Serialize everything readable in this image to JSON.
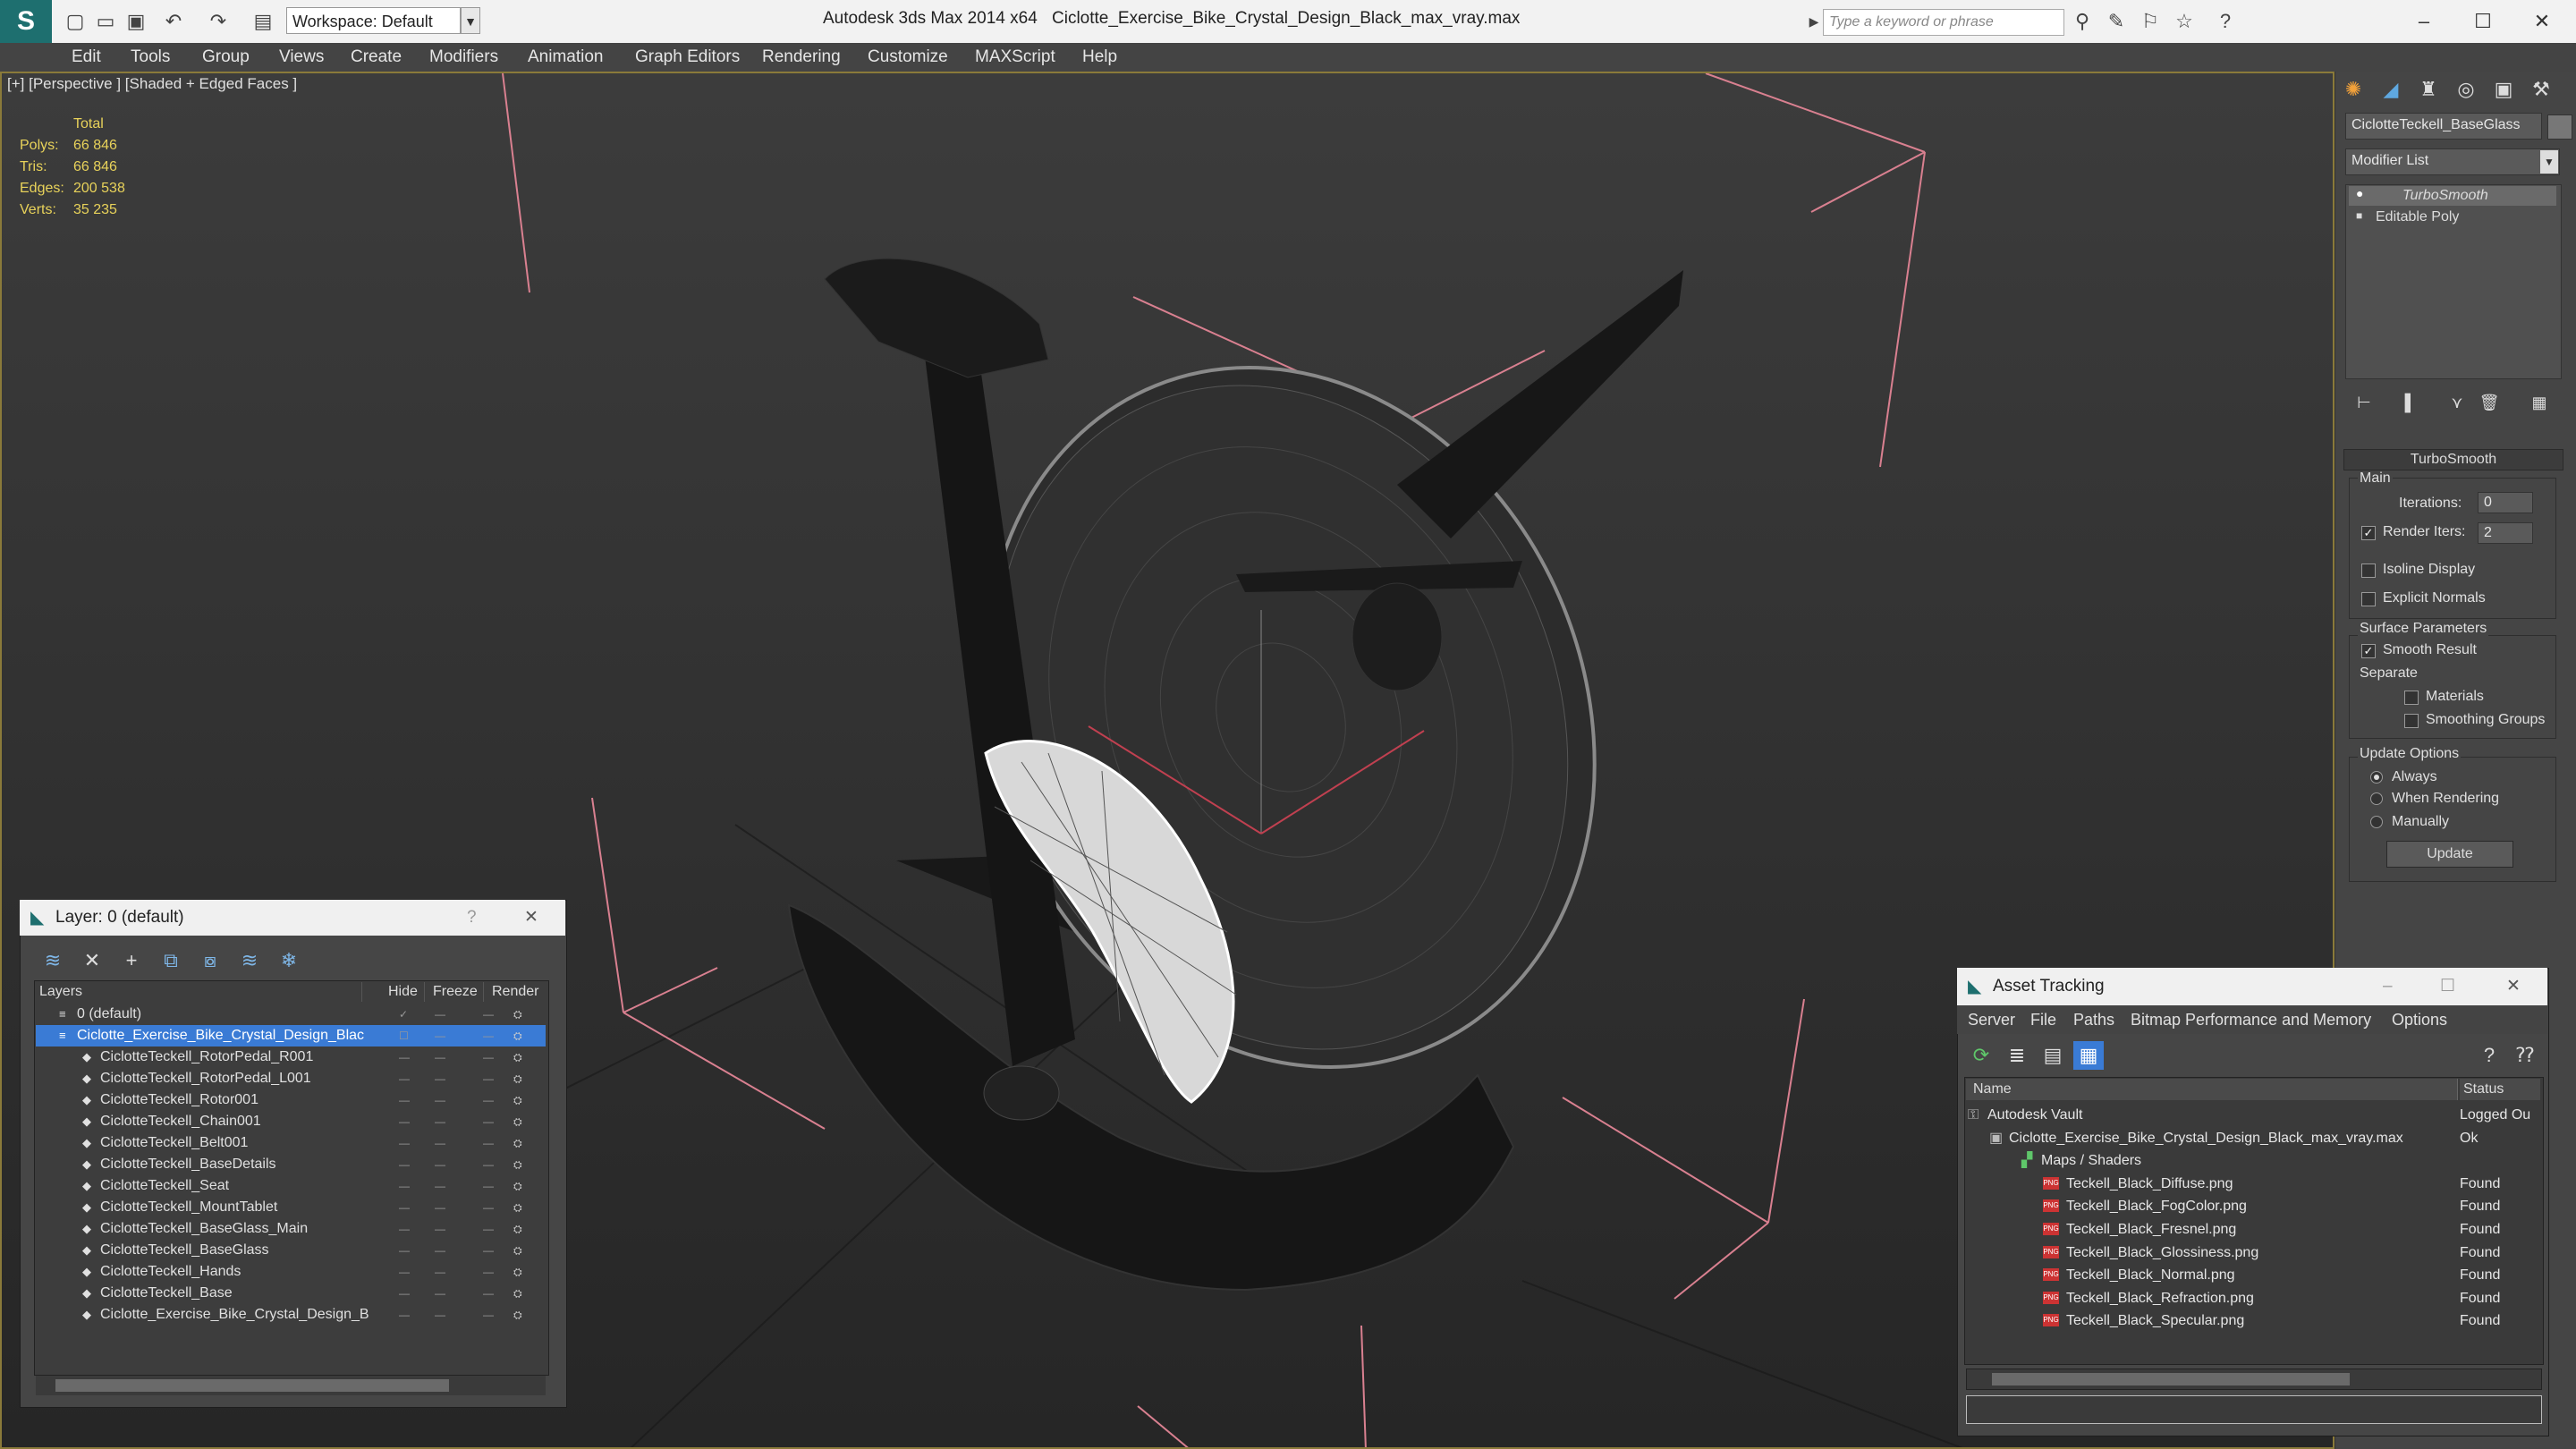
{
  "titlebar": {
    "app_title": "Autodesk 3ds Max  2014 x64",
    "file_name": "Ciclotte_Exercise_Bike_Crystal_Design_Black_max_vray.max",
    "workspace": "Workspace: Default",
    "search_placeholder": "Type a keyword or phrase"
  },
  "menu": [
    "Edit",
    "Tools",
    "Group",
    "Views",
    "Create",
    "Modifiers",
    "Animation",
    "Graph Editors",
    "Rendering",
    "Customize",
    "MAXScript",
    "Help"
  ],
  "viewport": {
    "label": "[+] [Perspective ] [Shaded + Edged Faces ]",
    "stats": {
      "header": "Total",
      "rows": [
        {
          "label": "Polys:",
          "value": "66 846"
        },
        {
          "label": "Tris:",
          "value": "66 846"
        },
        {
          "label": "Edges:",
          "value": "200 538"
        },
        {
          "label": "Verts:",
          "value": "35 235"
        }
      ]
    }
  },
  "command_panel": {
    "object_name": "CiclotteTeckell_BaseGlass",
    "modifier_list": "Modifier List",
    "stack": [
      "TurboSmooth",
      "Editable Poly"
    ],
    "rollout_title": "TurboSmooth",
    "main_label": "Main",
    "iterations_label": "Iterations:",
    "iterations_value": "0",
    "render_iters_label": "Render Iters:",
    "render_iters_value": "2",
    "isoline": "Isoline Display",
    "explicit": "Explicit Normals",
    "surface_params": "Surface Parameters",
    "smooth_result": "Smooth Result",
    "separate": "Separate",
    "materials": "Materials",
    "smoothing_groups": "Smoothing Groups",
    "update_options": "Update Options",
    "always": "Always",
    "when_rendering": "When Rendering",
    "manually": "Manually",
    "update_button": "Update"
  },
  "layer_dialog": {
    "title": "Layer: 0 (default)",
    "help": "?",
    "headers": {
      "layers": "Layers",
      "hide": "Hide",
      "freeze": "Freeze",
      "render": "Render"
    },
    "rows": [
      {
        "name": "0 (default)",
        "level": 0
      },
      {
        "name": "Ciclotte_Exercise_Bike_Crystal_Design_Blac",
        "level": 0,
        "selected": true
      },
      {
        "name": "CiclotteTeckell_RotorPedal_R001",
        "level": 1
      },
      {
        "name": "CiclotteTeckell_RotorPedal_L001",
        "level": 1
      },
      {
        "name": "CiclotteTeckell_Rotor001",
        "level": 1
      },
      {
        "name": "CiclotteTeckell_Chain001",
        "level": 1
      },
      {
        "name": "CiclotteTeckell_Belt001",
        "level": 1
      },
      {
        "name": "CiclotteTeckell_BaseDetails",
        "level": 1
      },
      {
        "name": "CiclotteTeckell_Seat",
        "level": 1
      },
      {
        "name": "CiclotteTeckell_MountTablet",
        "level": 1
      },
      {
        "name": "CiclotteTeckell_BaseGlass_Main",
        "level": 1
      },
      {
        "name": "CiclotteTeckell_BaseGlass",
        "level": 1
      },
      {
        "name": "CiclotteTeckell_Hands",
        "level": 1
      },
      {
        "name": "CiclotteTeckell_Base",
        "level": 1
      },
      {
        "name": "Ciclotte_Exercise_Bike_Crystal_Design_B",
        "level": 1
      }
    ]
  },
  "asset_tracking": {
    "title": "Asset Tracking",
    "menu": [
      "Server",
      "File",
      "Paths",
      "Bitmap Performance and Memory",
      "Options"
    ],
    "headers": {
      "name": "Name",
      "status": "Status"
    },
    "rows": [
      {
        "name": "Autodesk Vault",
        "status": "Logged Ou",
        "level": 0
      },
      {
        "name": "Ciclotte_Exercise_Bike_Crystal_Design_Black_max_vray.max",
        "status": "Ok",
        "level": 1
      },
      {
        "name": "Maps / Shaders",
        "status": "",
        "level": 2
      },
      {
        "name": "Teckell_Black_Diffuse.png",
        "status": "Found",
        "level": 3
      },
      {
        "name": "Teckell_Black_FogColor.png",
        "status": "Found",
        "level": 3
      },
      {
        "name": "Teckell_Black_Fresnel.png",
        "status": "Found",
        "level": 3
      },
      {
        "name": "Teckell_Black_Glossiness.png",
        "status": "Found",
        "level": 3
      },
      {
        "name": "Teckell_Black_Normal.png",
        "status": "Found",
        "level": 3
      },
      {
        "name": "Teckell_Black_Refraction.png",
        "status": "Found",
        "level": 3
      },
      {
        "name": "Teckell_Black_Specular.png",
        "status": "Found",
        "level": 3
      }
    ]
  },
  "colors": {
    "accent": "#3a7bd5",
    "stat_yellow": "#e8d25a",
    "viewport_border": "#8a7a3a"
  }
}
